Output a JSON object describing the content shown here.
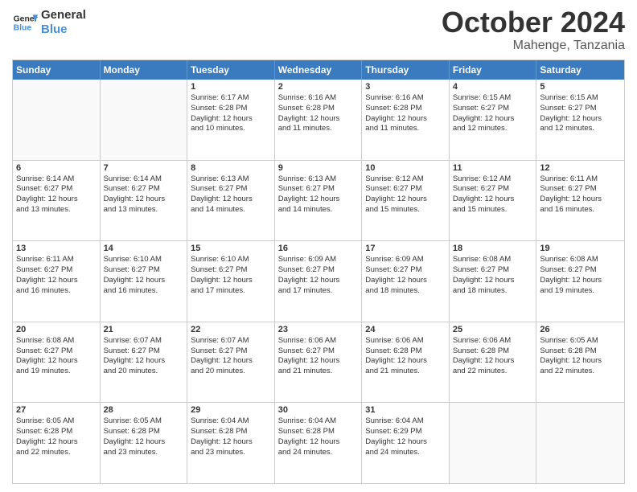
{
  "logo": {
    "line1": "General",
    "line2": "Blue"
  },
  "title": "October 2024",
  "subtitle": "Mahenge, Tanzania",
  "header_days": [
    "Sunday",
    "Monday",
    "Tuesday",
    "Wednesday",
    "Thursday",
    "Friday",
    "Saturday"
  ],
  "weeks": [
    [
      {
        "day": "",
        "lines": [],
        "empty": true
      },
      {
        "day": "",
        "lines": [],
        "empty": true
      },
      {
        "day": "1",
        "lines": [
          "Sunrise: 6:17 AM",
          "Sunset: 6:28 PM",
          "Daylight: 12 hours",
          "and 10 minutes."
        ]
      },
      {
        "day": "2",
        "lines": [
          "Sunrise: 6:16 AM",
          "Sunset: 6:28 PM",
          "Daylight: 12 hours",
          "and 11 minutes."
        ]
      },
      {
        "day": "3",
        "lines": [
          "Sunrise: 6:16 AM",
          "Sunset: 6:28 PM",
          "Daylight: 12 hours",
          "and 11 minutes."
        ]
      },
      {
        "day": "4",
        "lines": [
          "Sunrise: 6:15 AM",
          "Sunset: 6:27 PM",
          "Daylight: 12 hours",
          "and 12 minutes."
        ]
      },
      {
        "day": "5",
        "lines": [
          "Sunrise: 6:15 AM",
          "Sunset: 6:27 PM",
          "Daylight: 12 hours",
          "and 12 minutes."
        ]
      }
    ],
    [
      {
        "day": "6",
        "lines": [
          "Sunrise: 6:14 AM",
          "Sunset: 6:27 PM",
          "Daylight: 12 hours",
          "and 13 minutes."
        ]
      },
      {
        "day": "7",
        "lines": [
          "Sunrise: 6:14 AM",
          "Sunset: 6:27 PM",
          "Daylight: 12 hours",
          "and 13 minutes."
        ]
      },
      {
        "day": "8",
        "lines": [
          "Sunrise: 6:13 AM",
          "Sunset: 6:27 PM",
          "Daylight: 12 hours",
          "and 14 minutes."
        ]
      },
      {
        "day": "9",
        "lines": [
          "Sunrise: 6:13 AM",
          "Sunset: 6:27 PM",
          "Daylight: 12 hours",
          "and 14 minutes."
        ]
      },
      {
        "day": "10",
        "lines": [
          "Sunrise: 6:12 AM",
          "Sunset: 6:27 PM",
          "Daylight: 12 hours",
          "and 15 minutes."
        ]
      },
      {
        "day": "11",
        "lines": [
          "Sunrise: 6:12 AM",
          "Sunset: 6:27 PM",
          "Daylight: 12 hours",
          "and 15 minutes."
        ]
      },
      {
        "day": "12",
        "lines": [
          "Sunrise: 6:11 AM",
          "Sunset: 6:27 PM",
          "Daylight: 12 hours",
          "and 16 minutes."
        ]
      }
    ],
    [
      {
        "day": "13",
        "lines": [
          "Sunrise: 6:11 AM",
          "Sunset: 6:27 PM",
          "Daylight: 12 hours",
          "and 16 minutes."
        ]
      },
      {
        "day": "14",
        "lines": [
          "Sunrise: 6:10 AM",
          "Sunset: 6:27 PM",
          "Daylight: 12 hours",
          "and 16 minutes."
        ]
      },
      {
        "day": "15",
        "lines": [
          "Sunrise: 6:10 AM",
          "Sunset: 6:27 PM",
          "Daylight: 12 hours",
          "and 17 minutes."
        ]
      },
      {
        "day": "16",
        "lines": [
          "Sunrise: 6:09 AM",
          "Sunset: 6:27 PM",
          "Daylight: 12 hours",
          "and 17 minutes."
        ]
      },
      {
        "day": "17",
        "lines": [
          "Sunrise: 6:09 AM",
          "Sunset: 6:27 PM",
          "Daylight: 12 hours",
          "and 18 minutes."
        ]
      },
      {
        "day": "18",
        "lines": [
          "Sunrise: 6:08 AM",
          "Sunset: 6:27 PM",
          "Daylight: 12 hours",
          "and 18 minutes."
        ]
      },
      {
        "day": "19",
        "lines": [
          "Sunrise: 6:08 AM",
          "Sunset: 6:27 PM",
          "Daylight: 12 hours",
          "and 19 minutes."
        ]
      }
    ],
    [
      {
        "day": "20",
        "lines": [
          "Sunrise: 6:08 AM",
          "Sunset: 6:27 PM",
          "Daylight: 12 hours",
          "and 19 minutes."
        ]
      },
      {
        "day": "21",
        "lines": [
          "Sunrise: 6:07 AM",
          "Sunset: 6:27 PM",
          "Daylight: 12 hours",
          "and 20 minutes."
        ]
      },
      {
        "day": "22",
        "lines": [
          "Sunrise: 6:07 AM",
          "Sunset: 6:27 PM",
          "Daylight: 12 hours",
          "and 20 minutes."
        ]
      },
      {
        "day": "23",
        "lines": [
          "Sunrise: 6:06 AM",
          "Sunset: 6:27 PM",
          "Daylight: 12 hours",
          "and 21 minutes."
        ]
      },
      {
        "day": "24",
        "lines": [
          "Sunrise: 6:06 AM",
          "Sunset: 6:28 PM",
          "Daylight: 12 hours",
          "and 21 minutes."
        ]
      },
      {
        "day": "25",
        "lines": [
          "Sunrise: 6:06 AM",
          "Sunset: 6:28 PM",
          "Daylight: 12 hours",
          "and 22 minutes."
        ]
      },
      {
        "day": "26",
        "lines": [
          "Sunrise: 6:05 AM",
          "Sunset: 6:28 PM",
          "Daylight: 12 hours",
          "and 22 minutes."
        ]
      }
    ],
    [
      {
        "day": "27",
        "lines": [
          "Sunrise: 6:05 AM",
          "Sunset: 6:28 PM",
          "Daylight: 12 hours",
          "and 22 minutes."
        ]
      },
      {
        "day": "28",
        "lines": [
          "Sunrise: 6:05 AM",
          "Sunset: 6:28 PM",
          "Daylight: 12 hours",
          "and 23 minutes."
        ]
      },
      {
        "day": "29",
        "lines": [
          "Sunrise: 6:04 AM",
          "Sunset: 6:28 PM",
          "Daylight: 12 hours",
          "and 23 minutes."
        ]
      },
      {
        "day": "30",
        "lines": [
          "Sunrise: 6:04 AM",
          "Sunset: 6:28 PM",
          "Daylight: 12 hours",
          "and 24 minutes."
        ]
      },
      {
        "day": "31",
        "lines": [
          "Sunrise: 6:04 AM",
          "Sunset: 6:29 PM",
          "Daylight: 12 hours",
          "and 24 minutes."
        ]
      },
      {
        "day": "",
        "lines": [],
        "empty": true
      },
      {
        "day": "",
        "lines": [],
        "empty": true
      }
    ]
  ]
}
